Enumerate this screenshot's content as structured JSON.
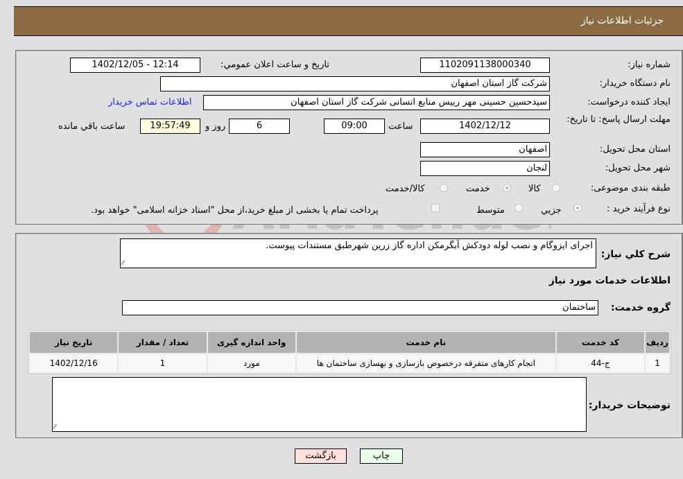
{
  "header": {
    "title": "جزئیات اطلاعات نیاز"
  },
  "form": {
    "need_number": {
      "label": "شماره نیاز:",
      "value": "1102091138000340"
    },
    "announce_datetime": {
      "label": "تاریخ و ساعت اعلان عمومي:",
      "value": "1402/12/05 - 12:14"
    },
    "buyer_org": {
      "label": "نام دستگاه خریدار:",
      "value": "شرکت گاز استان اصفهان"
    },
    "requester": {
      "label": "ایجاد کننده درخواست:",
      "value": "سیدحسین حسینی مهر رییس منابع انسانی شرکت گاز استان اصفهان"
    },
    "buyer_contact_link": "اطلاعات تماس خریدار",
    "deadline": {
      "label": "مهلت ارسال پاسخ: تا تاریخ:",
      "date": "1402/12/12",
      "time_label": "ساعت",
      "time": "09:00",
      "days": "6",
      "days_label": "روز و",
      "remaining_time": "19:57:49",
      "remaining_label": "ساعت باقي مانده"
    },
    "delivery_province": {
      "label": "استان محل تحویل:",
      "value": "اصفهان"
    },
    "delivery_city": {
      "label": "شهر محل تحویل:",
      "value": "لنجان"
    },
    "category": {
      "label": "طبقه بندی موضوعی:",
      "options": [
        "کالا",
        "خدمت",
        "کالا/خدمت"
      ],
      "selected": "خدمت"
    },
    "purchase_process": {
      "label": "نوع فرآیند خرید :",
      "options": [
        "جزیي",
        "متوسط"
      ],
      "selected": "جزیي",
      "treasury_note": "پرداخت تمام یا بخشی از مبلغ خرید،از محل \"اسناد خزانه اسلامی\" خواهد بود."
    }
  },
  "details": {
    "general_desc_label": "شرح کلي نیاز:",
    "general_desc": "اجرای ایزوگام و نصب لوله دودکش آبگرمکن اداره گاز زرین شهرطبق مستندات پیوست.",
    "services_heading": "اطلاعات خدمات مورد نیاز",
    "service_group_label": "گروه خدمت:",
    "service_group": "ساختمان",
    "table": {
      "headers": [
        "ردیف",
        "کد خدمت",
        "نام خدمت",
        "واحد اندازه گیری",
        "تعداد / مقدار",
        "تاریخ نیاز"
      ],
      "rows": [
        [
          "1",
          "ج-44",
          "انجام کارهای متفرقه درخصوص بازسازی و بهسازی ساختمان ها",
          "مورد",
          "1",
          "1402/12/16"
        ]
      ]
    },
    "buyer_notes_label": "توضیحات خریدار:",
    "buyer_notes": ""
  },
  "buttons": {
    "print": "چاپ",
    "back": "بازگشت"
  },
  "watermark": "AriaTender.neT",
  "colors": {
    "header_bg": "#8b6c42",
    "print_bg": "#eaffea",
    "back_bg": "#ffdede",
    "link": "#1a1aff"
  }
}
